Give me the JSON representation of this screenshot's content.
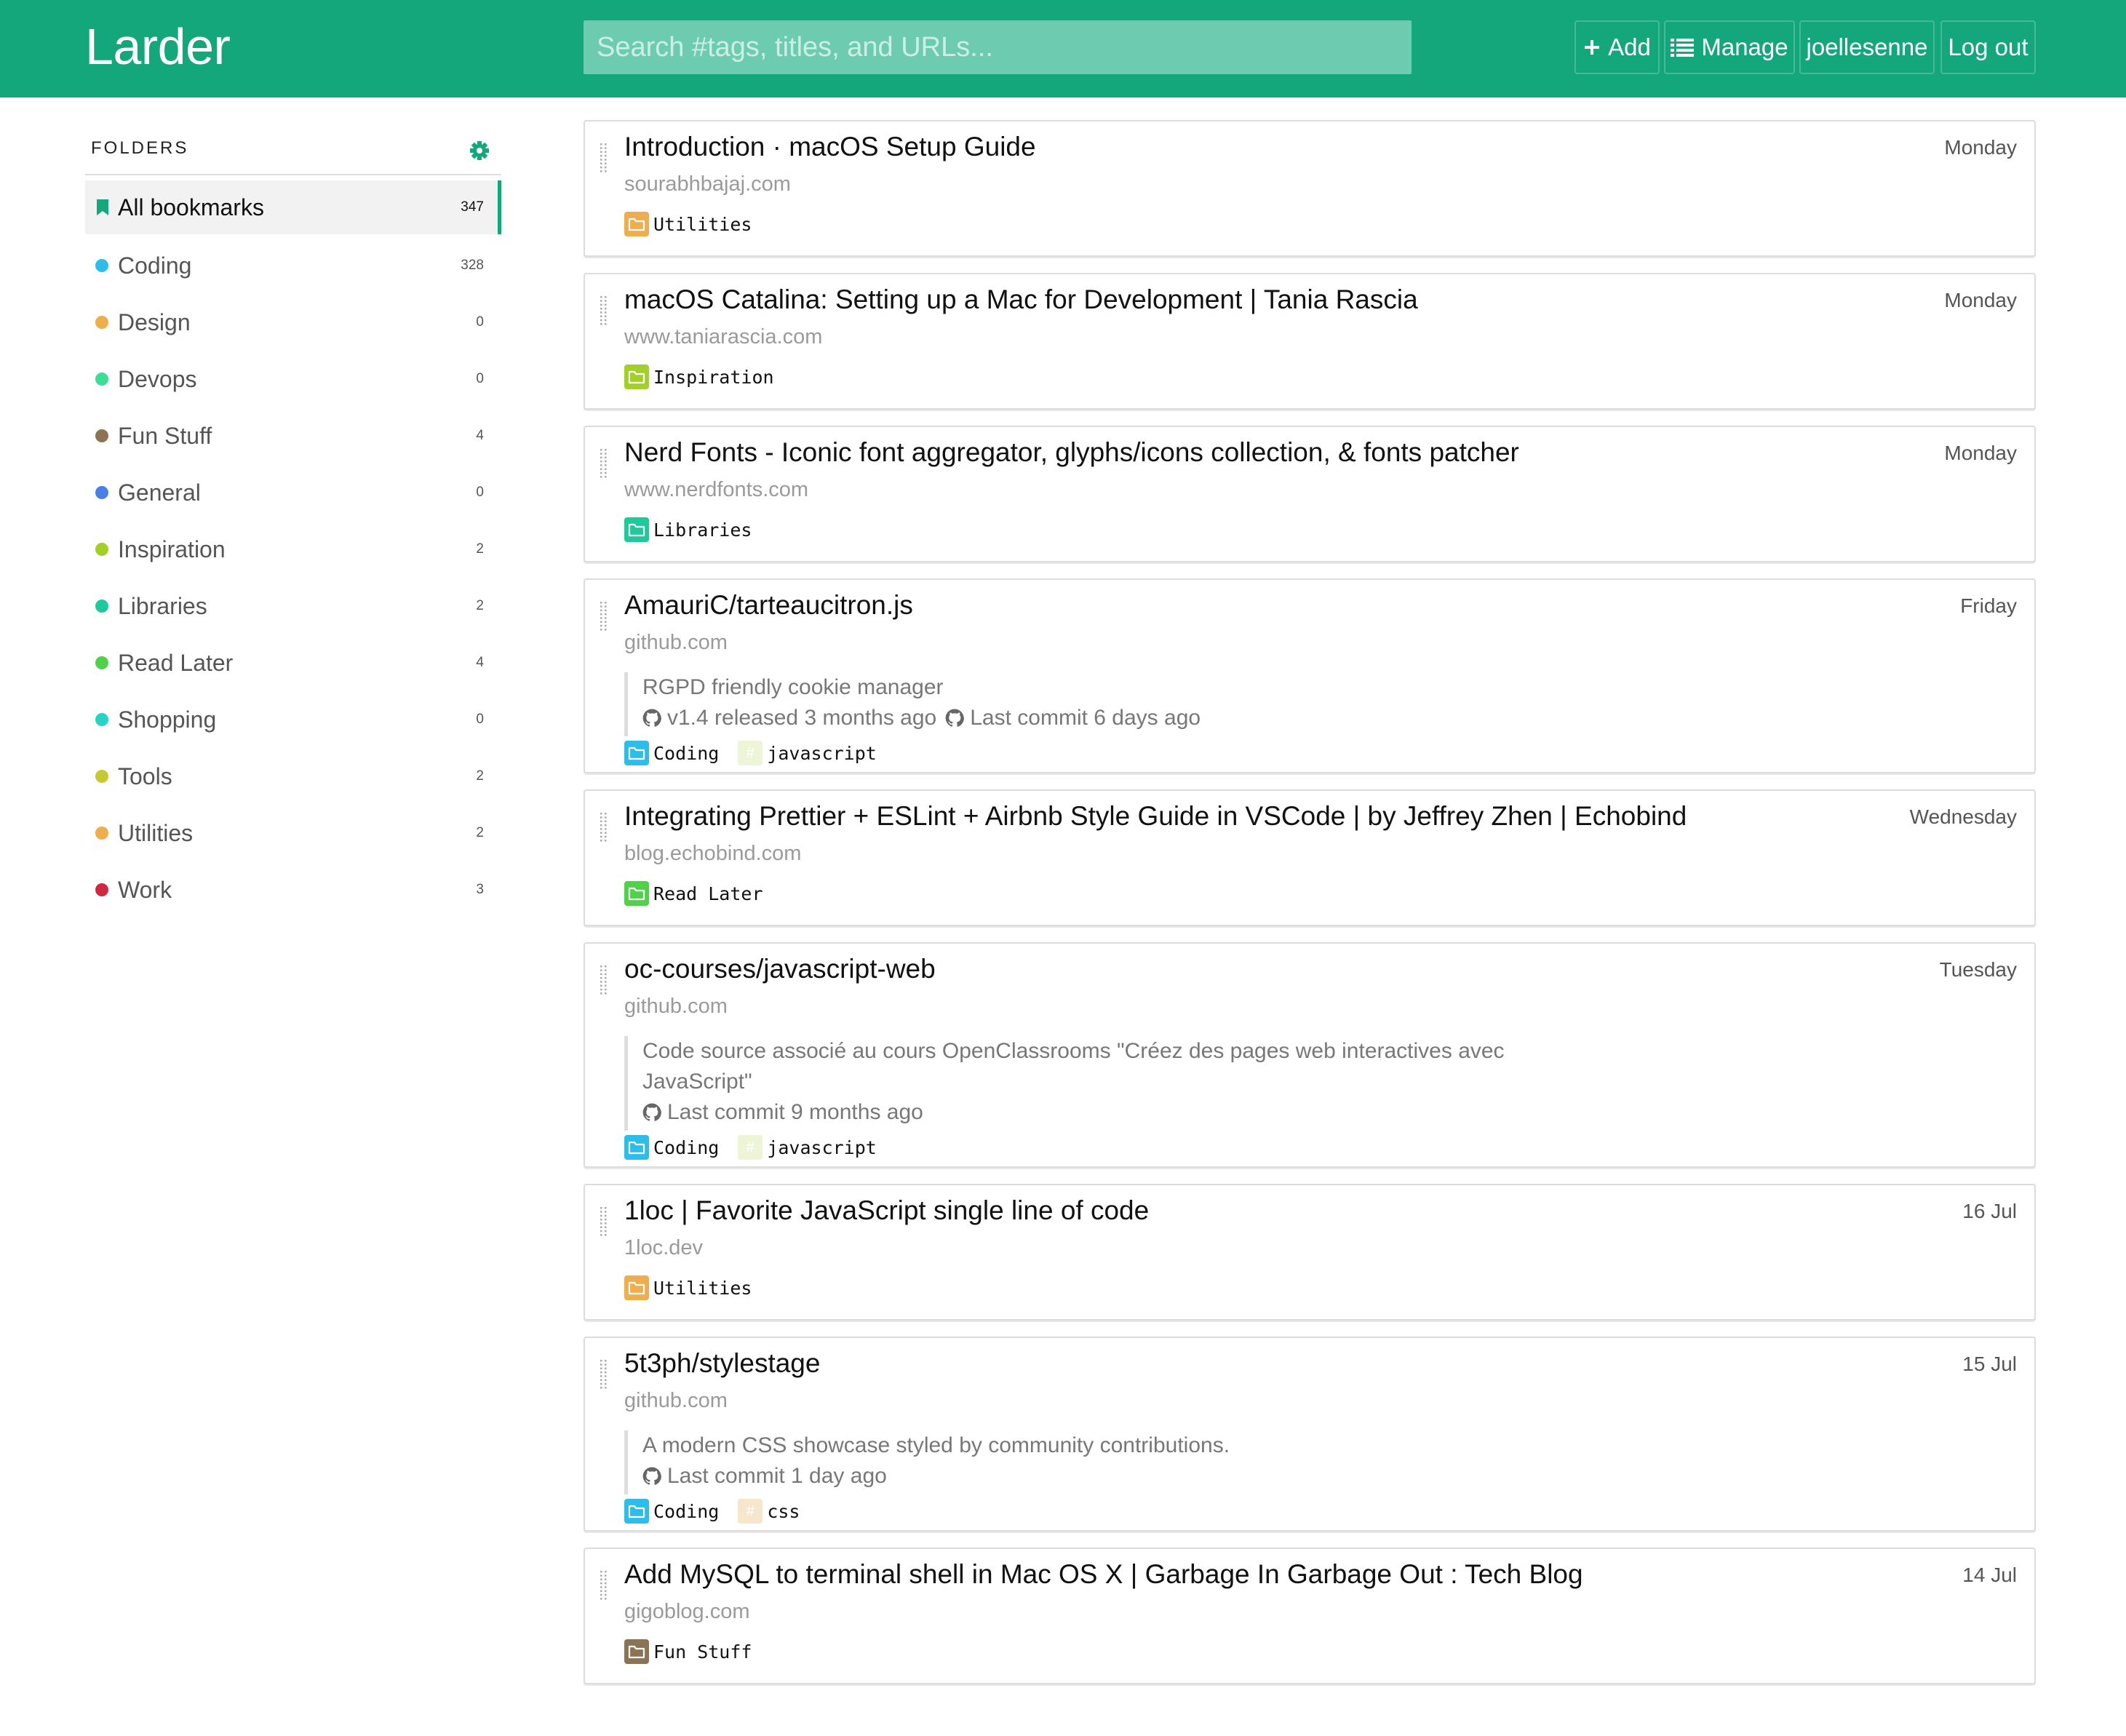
{
  "header": {
    "brand": "Larder",
    "search_placeholder": "Search #tags, titles, and URLs...",
    "add_label": "Add",
    "manage_label": "Manage",
    "user_label": "joellesenne",
    "logout_label": "Log out",
    "color": "#14a77b"
  },
  "sidebar": {
    "heading": "FOLDERS",
    "folders": [
      {
        "name": "All bookmarks",
        "count": "347",
        "color": "#14a77b",
        "active": true
      },
      {
        "name": "Coding",
        "count": "328",
        "color": "#2dbde8"
      },
      {
        "name": "Design",
        "count": "0",
        "color": "#f0ad4e"
      },
      {
        "name": "Devops",
        "count": "0",
        "color": "#3ddc97"
      },
      {
        "name": "Fun Stuff",
        "count": "4",
        "color": "#8c7354"
      },
      {
        "name": "General",
        "count": "0",
        "color": "#4a7fe8"
      },
      {
        "name": "Inspiration",
        "count": "2",
        "color": "#a3cf29"
      },
      {
        "name": "Libraries",
        "count": "2",
        "color": "#1ec99a"
      },
      {
        "name": "Read Later",
        "count": "4",
        "color": "#4fd14a"
      },
      {
        "name": "Shopping",
        "count": "0",
        "color": "#26d3c4"
      },
      {
        "name": "Tools",
        "count": "2",
        "color": "#c8c832"
      },
      {
        "name": "Utilities",
        "count": "2",
        "color": "#f0ad4e"
      },
      {
        "name": "Work",
        "count": "3",
        "color": "#d0293f"
      }
    ]
  },
  "bookmarks": [
    {
      "title": "Introduction · macOS Setup Guide",
      "domain": "sourabhbajaj.com",
      "date": "Monday",
      "tags": [
        {
          "kind": "folder",
          "label": "Utilities",
          "color": "#f0ad4e"
        }
      ]
    },
    {
      "title": "macOS Catalina: Setting up a Mac for Development | Tania Rascia",
      "domain": "www.taniarascia.com",
      "date": "Monday",
      "tags": [
        {
          "kind": "folder",
          "label": "Inspiration",
          "color": "#a3cf29"
        }
      ]
    },
    {
      "title": "Nerd Fonts - Iconic font aggregator, glyphs/icons collection, & fonts patcher",
      "domain": "www.nerdfonts.com",
      "date": "Monday",
      "tags": [
        {
          "kind": "folder",
          "label": "Libraries",
          "color": "#1ec99a"
        }
      ]
    },
    {
      "title": "AmauriC/tarteaucitron.js",
      "domain": "github.com",
      "date": "Friday",
      "description": {
        "lines": [
          "RGPD friendly cookie manager"
        ],
        "meta": [
          {
            "text": "v1.4 released 3 months ago"
          },
          {
            "text": "Last commit 6 days ago"
          }
        ]
      },
      "tags": [
        {
          "kind": "folder",
          "label": "Coding",
          "color": "#2dbde8"
        },
        {
          "kind": "hash",
          "label": "javascript",
          "color": "#eef5d6"
        }
      ]
    },
    {
      "title": "Integrating Prettier + ESLint + Airbnb Style Guide in VSCode | by Jeffrey Zhen | Echobind",
      "domain": "blog.echobind.com",
      "date": "Wednesday",
      "tags": [
        {
          "kind": "folder",
          "label": "Read Later",
          "color": "#4fd14a"
        }
      ]
    },
    {
      "title": "oc-courses/javascript-web",
      "domain": "github.com",
      "date": "Tuesday",
      "description": {
        "lines": [
          "Code source associé au cours OpenClassrooms \"Créez des pages web interactives avec",
          "JavaScript\""
        ],
        "meta": [
          {
            "text": "Last commit 9 months ago"
          }
        ]
      },
      "tags": [
        {
          "kind": "folder",
          "label": "Coding",
          "color": "#2dbde8"
        },
        {
          "kind": "hash",
          "label": "javascript",
          "color": "#eef5d6"
        }
      ]
    },
    {
      "title": "1loc | Favorite JavaScript single line of code",
      "domain": "1loc.dev",
      "date": "16 Jul",
      "tags": [
        {
          "kind": "folder",
          "label": "Utilities",
          "color": "#f0ad4e"
        }
      ]
    },
    {
      "title": "5t3ph/stylestage",
      "domain": "github.com",
      "date": "15 Jul",
      "description": {
        "lines": [
          "A modern CSS showcase styled by community contributions."
        ],
        "meta": [
          {
            "text": "Last commit 1 day ago"
          }
        ]
      },
      "tags": [
        {
          "kind": "folder",
          "label": "Coding",
          "color": "#2dbde8"
        },
        {
          "kind": "hash",
          "label": "css",
          "color": "#f6e6cc"
        }
      ]
    },
    {
      "title": "Add MySQL to terminal shell in Mac OS X | Garbage In Garbage Out : Tech Blog",
      "domain": "gigoblog.com",
      "date": "14 Jul",
      "tags": [
        {
          "kind": "folder",
          "label": "Fun Stuff",
          "color": "#8c7354"
        }
      ]
    }
  ]
}
